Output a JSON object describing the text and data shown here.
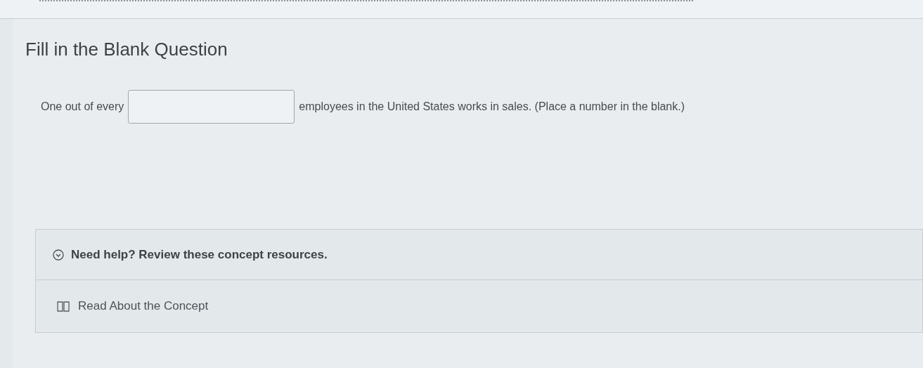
{
  "question": {
    "title": "Fill in the Blank Question",
    "before": "One out of every",
    "after": "employees in the United States works in sales. (Place a number in the blank.)"
  },
  "help": {
    "heading": "Need help? Review these concept resources.",
    "links": [
      {
        "label": "Read About the Concept"
      }
    ]
  }
}
